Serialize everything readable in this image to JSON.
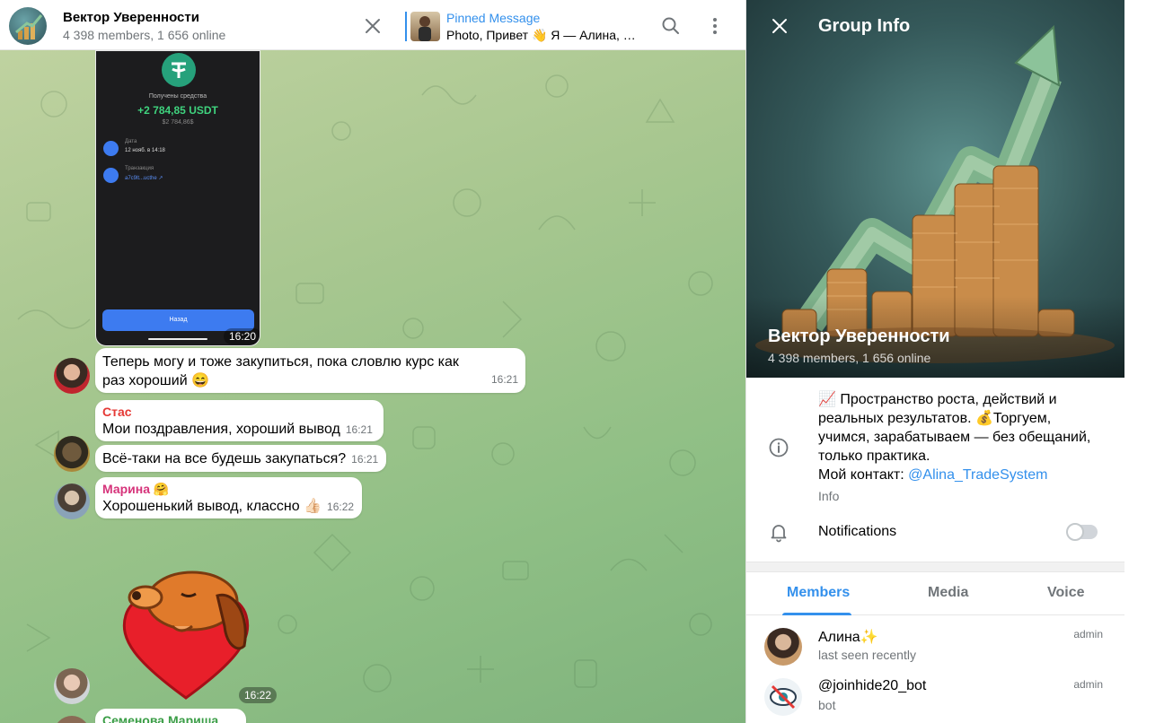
{
  "header": {
    "title": "Вектор Уверенности",
    "subtitle": "4 398 members, 1 656 online",
    "pinned_title": "Pinned Message",
    "pinned_text": "Photo, Привет 👋 Я — Алина, …"
  },
  "screenshot_msg": {
    "received_label": "Получены средства",
    "amount": "+2 784,85 USDT",
    "usd": "$2 784,86$",
    "date_key": "Дата",
    "date_val": "12 нояб. в 14:18",
    "tx_key": "Транзакция",
    "tx_val": "a7c9lt...ucthe ↗",
    "button": "Назад",
    "time": "16:20"
  },
  "messages": [
    {
      "text": "Теперь могу и тоже закупиться, пока словлю курс как раз хороший 😄",
      "time": "16:21"
    },
    {
      "sender": "Стас",
      "text": "Мои поздравления, хороший вывод",
      "time": "16:21"
    },
    {
      "text": "Всё-таки на все будешь закупаться?",
      "time": "16:21"
    },
    {
      "sender": "Марина 🤗",
      "text": "Хорошенький вывод, классно 👍🏻",
      "time": "16:22"
    },
    {
      "sticker_time": "16:22"
    },
    {
      "sender": "Семенова Мариша"
    }
  ],
  "colors": {
    "accent": "#3390ec",
    "sender_stas": "#e53935",
    "sender_marina": "#d6337a",
    "sender_semenova": "#3a9d46"
  },
  "info": {
    "title": "Group Info",
    "group_name": "Вектор Уверенности",
    "group_sub": "4 398 members, 1 656 online",
    "desc_line1": "📈 Пространство роста, действий и реальных результатов. 💰Торгуем, учимся, зарабатываем — без обещаний, только практика.",
    "desc_contact_prefix": "Мой контакт: ",
    "desc_contact_link": "@Alina_TradeSystem",
    "desc_caption": "Info",
    "notifications": "Notifications",
    "notifications_on": false,
    "tabs": [
      "Members",
      "Media",
      "Voice"
    ],
    "members": [
      {
        "name": "Алина✨",
        "status": "last seen recently",
        "role": "admin"
      },
      {
        "name": "@joinhide20_bot",
        "status": "bot",
        "role": "admin"
      }
    ]
  },
  "icons": {
    "close": "close-icon",
    "search": "search-icon",
    "more": "more-vertical-icon",
    "info": "info-icon",
    "bell": "bell-icon"
  }
}
